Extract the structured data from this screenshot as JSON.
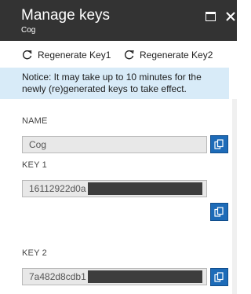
{
  "header": {
    "title": "Manage keys",
    "subtitle": "Cog"
  },
  "commands": [
    {
      "label": "Regenerate Key1",
      "icon": "refresh-1-icon"
    },
    {
      "label": "Regenerate Key2",
      "icon": "refresh-2-icon"
    }
  ],
  "notice": "Notice: It may take up to 10 minutes for the newly (re)generated keys to take effect.",
  "fields": {
    "name": {
      "label": "NAME",
      "value": "Cog"
    },
    "key1": {
      "label": "KEY 1",
      "value": "16112922d0a"
    },
    "key2": {
      "label": "KEY 2",
      "value": "7a482d8cdb1"
    }
  },
  "colors": {
    "header_bg": "#333333",
    "notice_bg": "#d8ebf8",
    "copy_button": "#1d6bb8"
  }
}
